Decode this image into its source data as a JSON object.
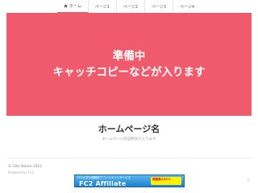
{
  "nav": {
    "items": [
      {
        "label": "ホーム"
      },
      {
        "label": "ページ1"
      },
      {
        "label": "ページ2"
      },
      {
        "label": "ページ3"
      },
      {
        "label": "ページ4"
      }
    ],
    "active_index": 0,
    "icon": "home-icon",
    "accent": "#e15d6d"
  },
  "hero": {
    "line1": "準備中",
    "line2": "キャッチコピーなどが入ります",
    "background": "#ef5b6c"
  },
  "site": {
    "title": "ホームページ名",
    "description": "ホームページの説明文が入ります"
  },
  "footer": {
    "text": "© Site Name 2022",
    "sub": "Powered by FC2",
    "mark": "©"
  },
  "banner": {
    "small_text": "FC2公式の報酬型アフィリエイトサービス",
    "main_text": "FC2 Affiliate",
    "badge_text": "報酬最大50%"
  }
}
